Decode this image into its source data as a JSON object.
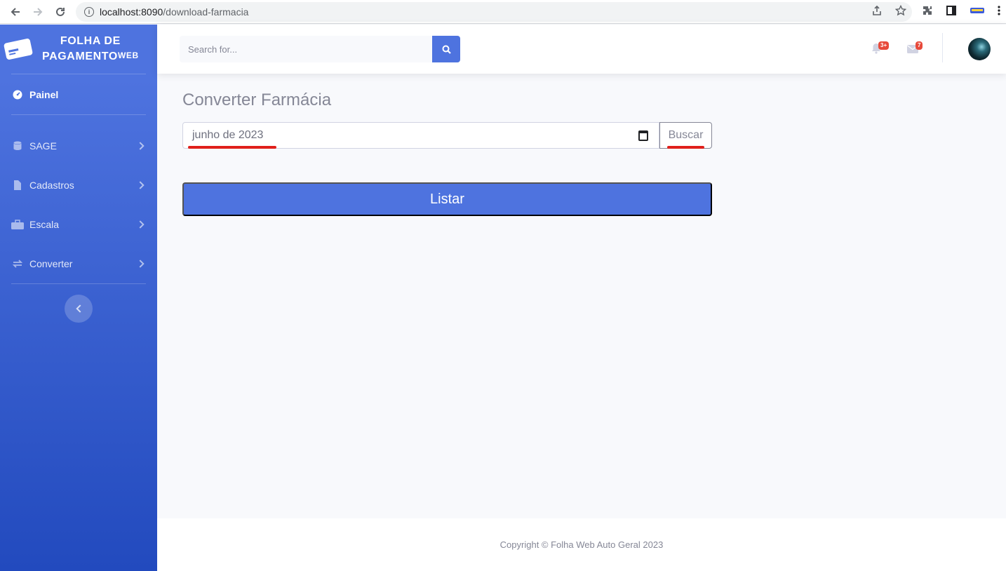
{
  "browser": {
    "url_host": "localhost:8090",
    "url_path": "/download-farmacia",
    "icons": [
      "back-arrow",
      "forward-arrow",
      "reload",
      "info",
      "share",
      "star",
      "extensions",
      "sidebar",
      "profile",
      "menu"
    ]
  },
  "sidebar": {
    "brand_line1": "FOLHA DE",
    "brand_line2": "PAGAMENTO",
    "brand_sup": "WEB",
    "items": [
      {
        "label": "Painel",
        "icon": "tachometer-icon",
        "active": true
      },
      {
        "label": "SAGE",
        "icon": "database-icon"
      },
      {
        "label": "Cadastros",
        "icon": "file-icon"
      },
      {
        "label": "Escala",
        "icon": "toolbox-icon"
      },
      {
        "label": "Converter",
        "icon": "exchange-icon"
      }
    ]
  },
  "topbar": {
    "search_placeholder": "Search for...",
    "alerts_badge": "3+",
    "messages_badge": "7"
  },
  "main": {
    "title": "Converter Farmácia",
    "date_value": "junho de 2023",
    "buscar_label": "Buscar",
    "listar_label": "Listar"
  },
  "footer": {
    "copyright": "Copyright © Folha Web Auto Geral 2023"
  },
  "colors": {
    "primary": "#4e73df",
    "primary_dark": "#224abe",
    "danger": "#e74a3b",
    "annotation": "#e0201b",
    "text_muted": "#858796"
  }
}
